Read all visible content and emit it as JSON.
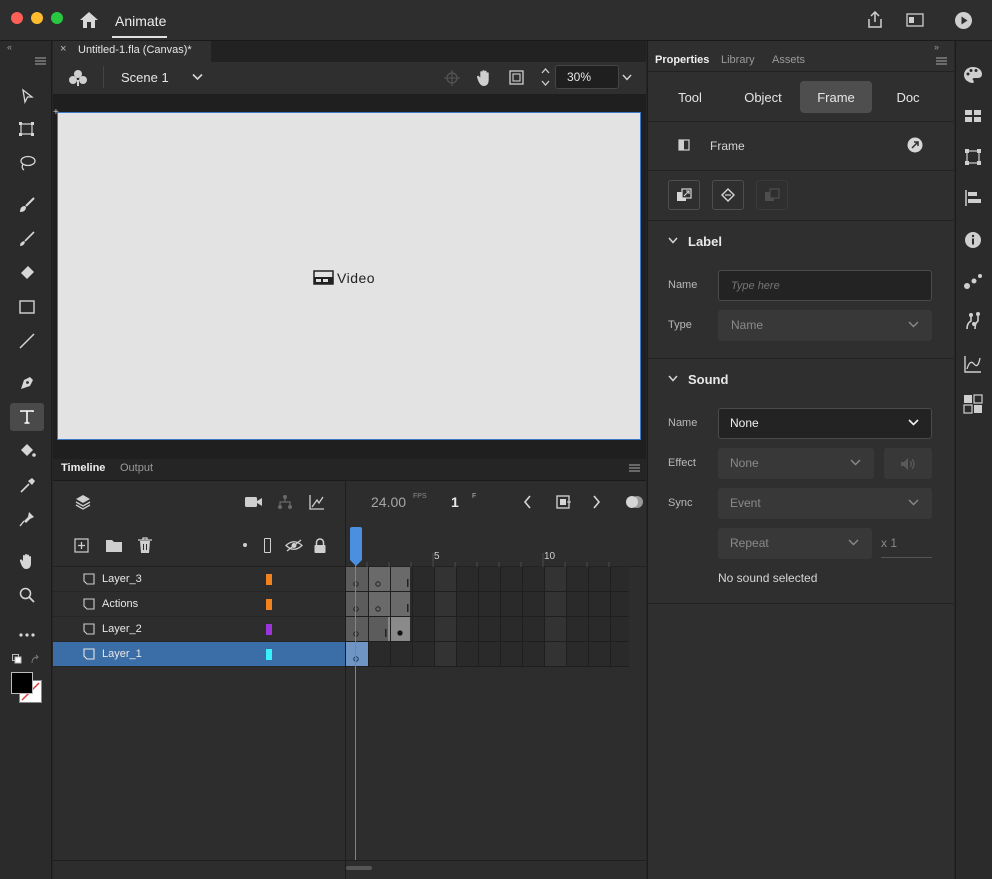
{
  "app": {
    "title": "Animate"
  },
  "document": {
    "tab_title": "Untitled-1.fla (Canvas)*",
    "scene": "Scene 1",
    "zoom": "30%",
    "canvas_text": "Video"
  },
  "timeline": {
    "tabs": [
      "Timeline",
      "Output"
    ],
    "fps": "24.00",
    "fps_unit": "FPS",
    "current_frame": "1",
    "frame_unit": "F",
    "ruler": [
      "5",
      "10"
    ],
    "layers": [
      {
        "name": "Layer_3",
        "color": "#f0821f",
        "selected": false
      },
      {
        "name": "Actions",
        "color": "#f0821f",
        "selected": false
      },
      {
        "name": "Layer_2",
        "color": "#9b34d9",
        "selected": false
      },
      {
        "name": "Layer_1",
        "color": "#3af0f8",
        "selected": true
      }
    ]
  },
  "properties": {
    "tabs": [
      "Properties",
      "Library",
      "Assets"
    ],
    "modes": [
      "Tool",
      "Object",
      "Frame",
      "Doc"
    ],
    "active_mode": "Frame",
    "section_title": "Frame",
    "label": {
      "heading": "Label",
      "name_label": "Name",
      "name_placeholder": "Type here",
      "type_label": "Type",
      "type_value": "Name"
    },
    "sound": {
      "heading": "Sound",
      "name_label": "Name",
      "name_value": "None",
      "effect_label": "Effect",
      "effect_value": "None",
      "sync_label": "Sync",
      "sync_value": "Event",
      "repeat_value": "Repeat",
      "repeat_count": "x 1",
      "status": "No sound selected"
    }
  },
  "colors": {
    "accent": "#3b6da6",
    "playhead": "#4a8fe0",
    "canvas_border": "#3b78c5"
  }
}
